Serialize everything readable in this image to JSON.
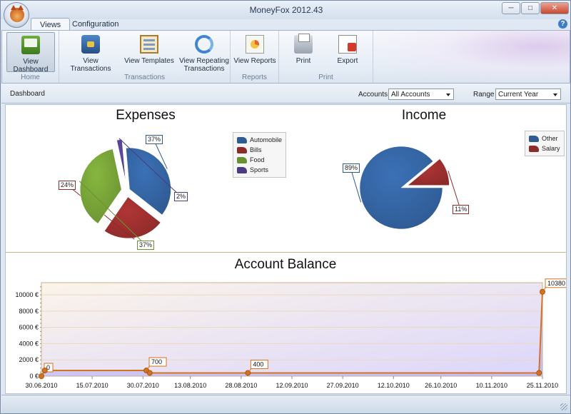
{
  "window": {
    "title": "MoneyFox 2012.43"
  },
  "window_controls": {
    "minimize": "─",
    "maximize": "□",
    "close": "✕"
  },
  "ribbon": {
    "tabs": [
      {
        "label": "Views",
        "active": true
      },
      {
        "label": "Configuration",
        "active": false
      }
    ],
    "help_label": "?",
    "groups": [
      {
        "label": "Home",
        "buttons": [
          {
            "label": "View Dashboard",
            "icon": "dashboard-icon",
            "active": true
          }
        ]
      },
      {
        "label": "Transactions",
        "buttons": [
          {
            "label": "View Transactions",
            "icon": "transactions-icon"
          },
          {
            "label": "View Templates",
            "icon": "templates-icon"
          },
          {
            "label": "View Repeating Transactions",
            "icon": "repeat-icon"
          }
        ]
      },
      {
        "label": "Reports",
        "buttons": [
          {
            "label": "View Reports",
            "icon": "reports-icon"
          }
        ]
      },
      {
        "label": "Print",
        "buttons": [
          {
            "label": "Print",
            "icon": "printer-icon"
          },
          {
            "label": "Export",
            "icon": "export-icon"
          }
        ]
      }
    ]
  },
  "filter_bar": {
    "title": "Dashboard",
    "accounts_label": "Accounts",
    "accounts_value": "All Accounts",
    "range_label": "Range",
    "range_value": "Current Year"
  },
  "colors": {
    "blue": "#2f5a92",
    "red": "#8d2a2a",
    "green": "#6b9232",
    "purple": "#4d3a80",
    "line": "#d4731f"
  },
  "chart_data": [
    {
      "type": "pie",
      "title": "Expenses",
      "slices": [
        {
          "name": "Automobile",
          "value": 37,
          "label": "37%"
        },
        {
          "name": "Bills",
          "value": 24,
          "label": "24%"
        },
        {
          "name": "Food",
          "value": 37,
          "label": "37%"
        },
        {
          "name": "Sports",
          "value": 2,
          "label": "2%"
        }
      ],
      "legend": "right"
    },
    {
      "type": "pie",
      "title": "Income",
      "slices": [
        {
          "name": "Other",
          "value": 89,
          "label": "89%"
        },
        {
          "name": "Salary",
          "value": 11,
          "label": "11%"
        }
      ],
      "legend": "top-right"
    },
    {
      "type": "area",
      "title": "Account Balance",
      "x_ticks": [
        "30.06.2010",
        "15.07.2010",
        "30.07.2010",
        "13.08.2010",
        "28.08.2010",
        "12.09.2010",
        "27.09.2010",
        "12.10.2010",
        "26.10.2010",
        "10.11.2010",
        "25.11.2010"
      ],
      "y_ticks": [
        "0 €",
        "2000 €",
        "4000 €",
        "6000 €",
        "8000 €",
        "10000 €"
      ],
      "ylim": [
        0,
        11500
      ],
      "series": [
        {
          "points": [
            {
              "x": "30.06.2010",
              "y": 0,
              "label": "0"
            },
            {
              "x": "01.07.2010",
              "y": 700,
              "label": ""
            },
            {
              "x": "31.07.2010",
              "y": 700,
              "label": "700"
            },
            {
              "x": "01.08.2010",
              "y": 400,
              "label": ""
            },
            {
              "x": "30.08.2010",
              "y": 400,
              "label": "400"
            },
            {
              "x": "24.11.2010",
              "y": 400,
              "label": ""
            },
            {
              "x": "25.11.2010",
              "y": 10380,
              "label": "10380"
            }
          ]
        }
      ]
    }
  ]
}
